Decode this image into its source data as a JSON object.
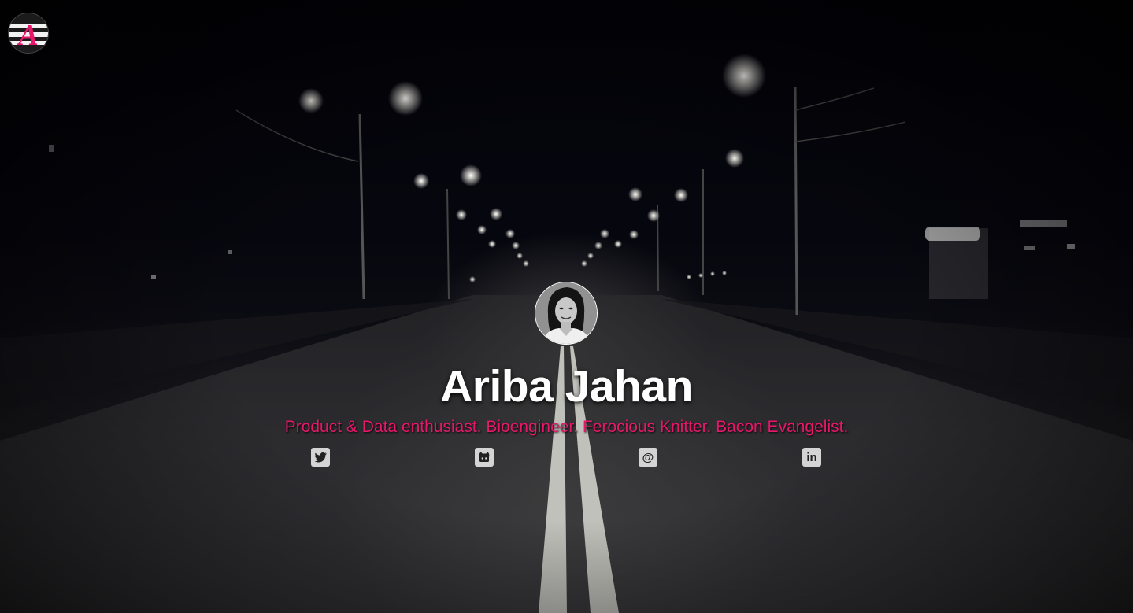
{
  "profile": {
    "name": "Ariba Jahan",
    "tagline": "Product & Data enthusiast. Bioengineer. Ferocious Knitter. Bacon Evangelist."
  },
  "logo": {
    "icon": "ariba-logo-icon",
    "letter": "A"
  },
  "social": [
    {
      "name": "twitter",
      "icon": "twitter-icon"
    },
    {
      "name": "github",
      "icon": "github-icon"
    },
    {
      "name": "email",
      "icon": "at-sign-icon",
      "glyph": "@"
    },
    {
      "name": "linkedin",
      "icon": "linkedin-icon",
      "glyph": "in"
    }
  ],
  "colors": {
    "accent": "#e8176b",
    "name_text": "#ffffff",
    "icon_bg": "#d4d4d4",
    "background": "#05050c"
  }
}
